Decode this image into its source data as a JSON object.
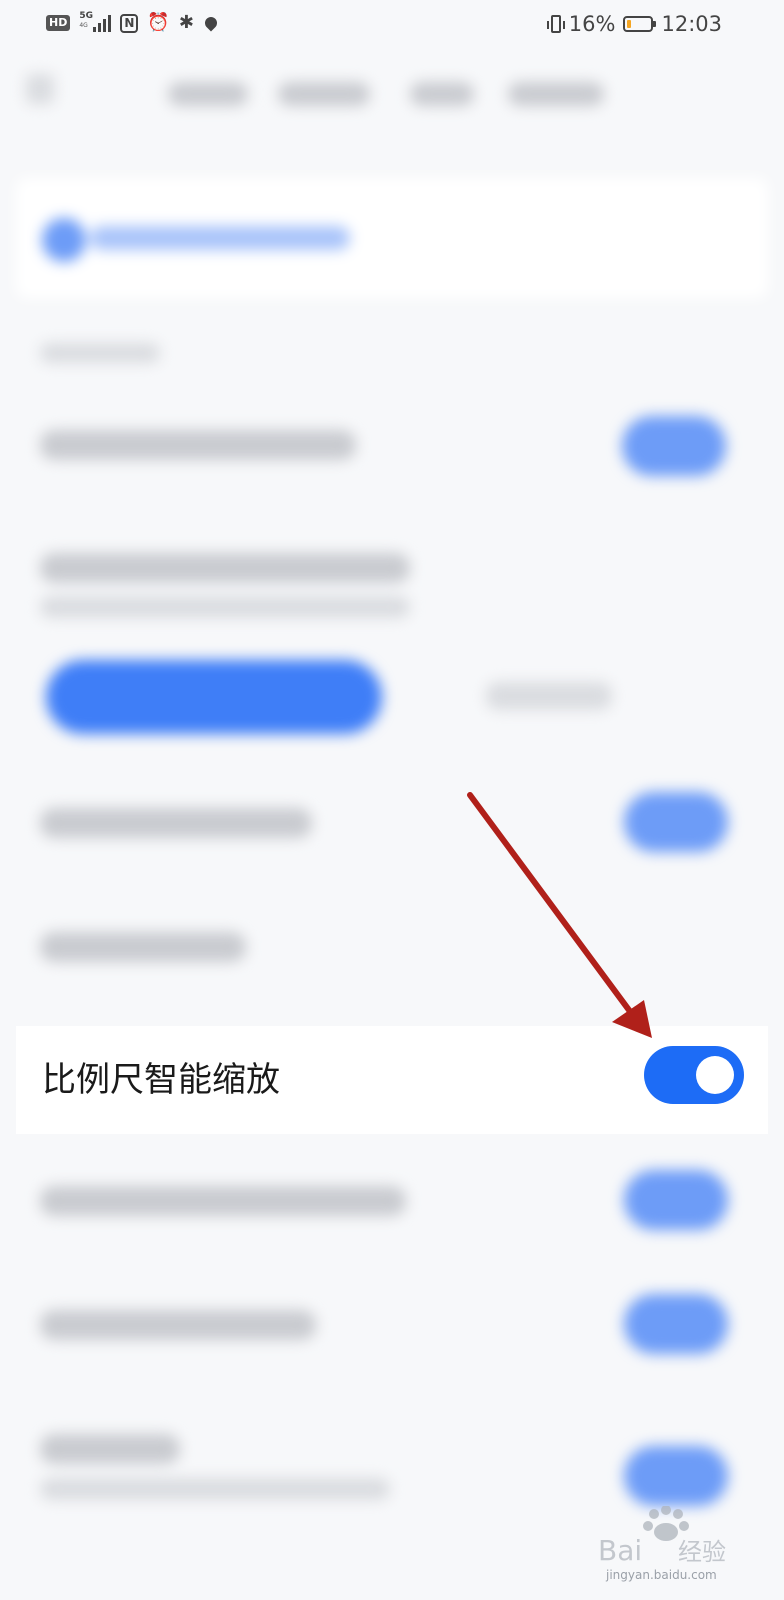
{
  "status_bar": {
    "hd_badge": "HD",
    "network": "5G",
    "network_sub": "4G",
    "icons": [
      "hd-icon",
      "signal-icon",
      "nfc-icon",
      "alarm-icon",
      "bluetooth-icon",
      "location-icon",
      "vibrate-icon",
      "battery-icon"
    ],
    "battery_percent": "16%",
    "battery_level": 0.16,
    "time": "12:03"
  },
  "setting": {
    "label": "比例尺智能缩放",
    "toggle_on": true
  },
  "annotation": {
    "arrow_color": "#b0201a"
  },
  "watermark": {
    "brand": "Baidu经验",
    "url": "jingyan.baidu.com"
  },
  "colors": {
    "accent": "#1d6cf6",
    "background": "#f7f8fa",
    "row_background": "#ffffff"
  }
}
